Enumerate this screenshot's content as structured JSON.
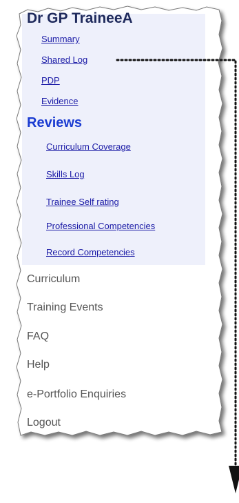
{
  "profile": {
    "name": "Dr GP TraineeA"
  },
  "quick_links": [
    {
      "label": "Summary"
    },
    {
      "label": "Shared Log"
    },
    {
      "label": "PDP"
    },
    {
      "label": "Evidence"
    }
  ],
  "reviews": {
    "heading": "Reviews",
    "items": [
      {
        "label": "Curriculum Coverage"
      },
      {
        "label": "Skills Log"
      },
      {
        "label": "Trainee Self rating"
      },
      {
        "label": "Professional Competencies"
      },
      {
        "label": "Record Competencies"
      }
    ]
  },
  "menu": [
    {
      "label": "Curriculum"
    },
    {
      "label": "Training Events"
    },
    {
      "label": "FAQ"
    },
    {
      "label": "Help"
    },
    {
      "label": "e-Portfolio Enquiries"
    },
    {
      "label": "Logout"
    }
  ],
  "colors": {
    "link": "#1a1aa6",
    "heading": "#1a3bd1",
    "panel_background": "#eef0fb",
    "menu_text": "#555555",
    "annotation": "#111111"
  },
  "icons": {
    "annotation_arrow": "dotted-arrow-icon"
  }
}
